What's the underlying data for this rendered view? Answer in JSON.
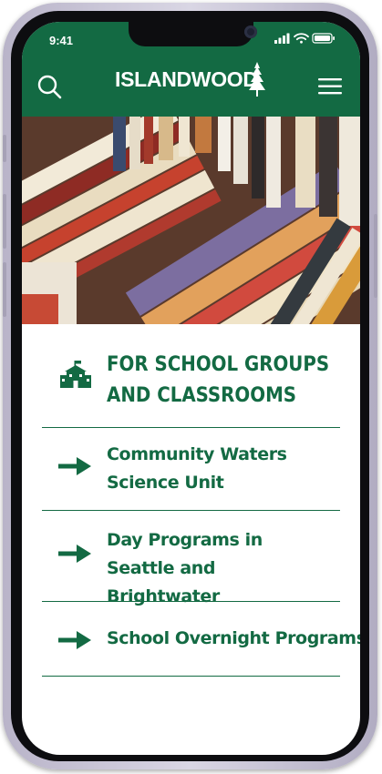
{
  "status_bar": {
    "time": "9:41"
  },
  "header": {
    "logo_text": "ISLANDWOOD"
  },
  "section": {
    "title": "FOR SCHOOL GROUPS AND CLASSROOMS"
  },
  "programs": [
    {
      "label": "Community Waters Science Unit"
    },
    {
      "label": "Day Programs in Seattle and Brightwater"
    },
    {
      "label": "School Overnight Programs"
    }
  ],
  "colors": {
    "brand_green": "#136a43",
    "background": "#ffffff"
  },
  "icons": {
    "search": "search-icon",
    "menu": "hamburger-menu-icon",
    "school": "school-building-icon",
    "arrow": "arrow-right-icon"
  }
}
